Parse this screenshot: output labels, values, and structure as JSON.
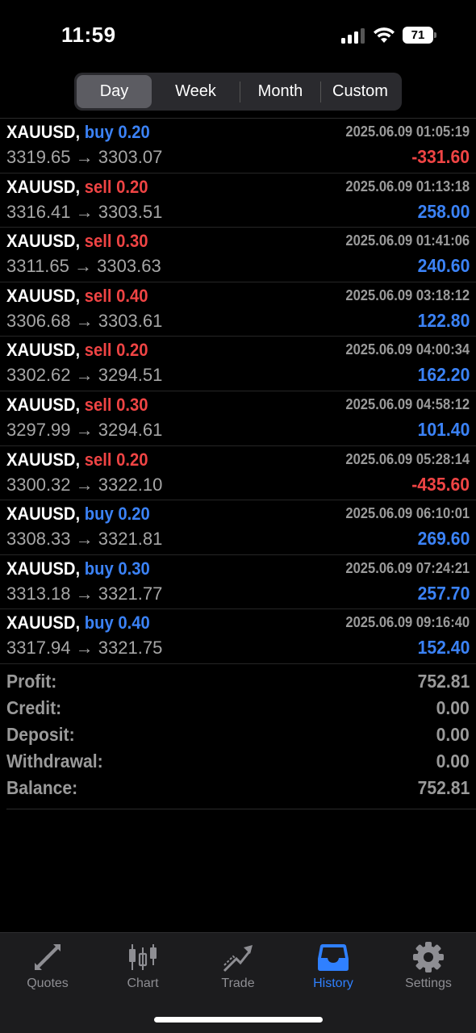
{
  "status_bar": {
    "time": "11:59",
    "battery": "71"
  },
  "period_tabs": [
    {
      "label": "Day",
      "active": true
    },
    {
      "label": "Week",
      "active": false
    },
    {
      "label": "Month",
      "active": false
    },
    {
      "label": "Custom",
      "active": false
    }
  ],
  "trades": [
    {
      "symbol": "XAUUSD,",
      "side": "buy 0.20",
      "type": "buy",
      "time": "2025.06.09 01:05:19",
      "open": "3319.65",
      "close": "3303.07",
      "arrow": "→",
      "profit": "-331.60"
    },
    {
      "symbol": "XAUUSD,",
      "side": "sell 0.20",
      "type": "sell",
      "time": "2025.06.09 01:13:18",
      "open": "3316.41",
      "close": "3303.51",
      "arrow": "→",
      "profit": "258.00"
    },
    {
      "symbol": "XAUUSD,",
      "side": "sell 0.30",
      "type": "sell",
      "time": "2025.06.09 01:41:06",
      "open": "3311.65",
      "close": "3303.63",
      "arrow": "→",
      "profit": "240.60"
    },
    {
      "symbol": "XAUUSD,",
      "side": "sell 0.40",
      "type": "sell",
      "time": "2025.06.09 03:18:12",
      "open": "3306.68",
      "close": "3303.61",
      "arrow": "→",
      "profit": "122.80"
    },
    {
      "symbol": "XAUUSD,",
      "side": "sell 0.20",
      "type": "sell",
      "time": "2025.06.09 04:00:34",
      "open": "3302.62",
      "close": "3294.51",
      "arrow": "→",
      "profit": "162.20"
    },
    {
      "symbol": "XAUUSD,",
      "side": "sell 0.30",
      "type": "sell",
      "time": "2025.06.09 04:58:12",
      "open": "3297.99",
      "close": "3294.61",
      "arrow": "→",
      "profit": "101.40"
    },
    {
      "symbol": "XAUUSD,",
      "side": "sell 0.20",
      "type": "sell",
      "time": "2025.06.09 05:28:14",
      "open": "3300.32",
      "close": "3322.10",
      "arrow": "→",
      "profit": "-435.60"
    },
    {
      "symbol": "XAUUSD,",
      "side": "buy 0.20",
      "type": "buy",
      "time": "2025.06.09 06:10:01",
      "open": "3308.33",
      "close": "3321.81",
      "arrow": "→",
      "profit": "269.60"
    },
    {
      "symbol": "XAUUSD,",
      "side": "buy 0.30",
      "type": "buy",
      "time": "2025.06.09 07:24:21",
      "open": "3313.18",
      "close": "3321.77",
      "arrow": "→",
      "profit": "257.70"
    },
    {
      "symbol": "XAUUSD,",
      "side": "buy 0.40",
      "type": "buy",
      "time": "2025.06.09 09:16:40",
      "open": "3317.94",
      "close": "3321.75",
      "arrow": "→",
      "profit": "152.40"
    }
  ],
  "summary": [
    {
      "label": "Profit:",
      "value": "752.81"
    },
    {
      "label": "Credit:",
      "value": "0.00"
    },
    {
      "label": "Deposit:",
      "value": "0.00"
    },
    {
      "label": "Withdrawal:",
      "value": "0.00"
    },
    {
      "label": "Balance:",
      "value": "752.81"
    }
  ],
  "tab_bar": [
    {
      "label": "Quotes",
      "icon": "quotes-arrows-icon",
      "active": false
    },
    {
      "label": "Chart",
      "icon": "candlestick-chart-icon",
      "active": false
    },
    {
      "label": "Trade",
      "icon": "trade-trend-icon",
      "active": false
    },
    {
      "label": "History",
      "icon": "inbox-tray-icon",
      "active": true
    },
    {
      "label": "Settings",
      "icon": "gear-icon",
      "active": false
    }
  ],
  "colors": {
    "buy": "#3b82f6",
    "sell": "#ef4444",
    "active_tab": "#2f80ff",
    "muted": "#9a9a9a"
  }
}
